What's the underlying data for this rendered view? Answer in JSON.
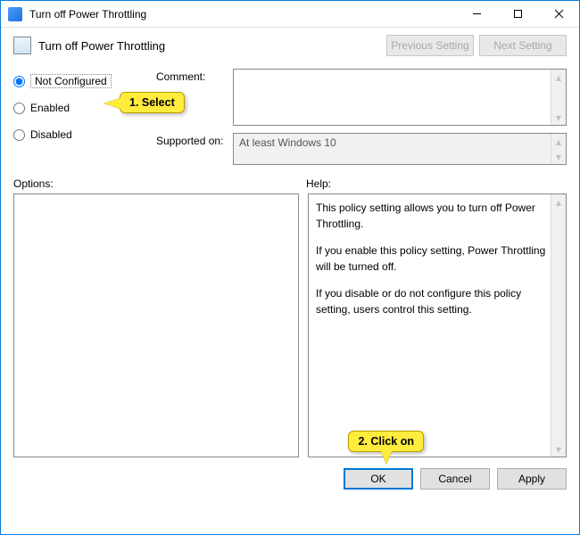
{
  "window": {
    "title": "Turn off Power Throttling"
  },
  "header": {
    "policy_title": "Turn off Power Throttling",
    "previous_setting": "Previous Setting",
    "next_setting": "Next Setting"
  },
  "radios": {
    "not_configured": "Not Configured",
    "enabled": "Enabled",
    "disabled": "Disabled",
    "selected": "not_configured"
  },
  "fields": {
    "comment_label": "Comment:",
    "comment_value": "",
    "supported_label": "Supported on:",
    "supported_value": "At least Windows 10"
  },
  "sections": {
    "options_label": "Options:",
    "help_label": "Help:"
  },
  "help": {
    "p1": "This policy setting allows you to turn off Power Throttling.",
    "p2": "If you enable this policy setting, Power Throttling will be turned off.",
    "p3": "If you disable or do not configure this policy setting, users control this setting."
  },
  "buttons": {
    "ok": "OK",
    "cancel": "Cancel",
    "apply": "Apply"
  },
  "annotations": {
    "select": "1. Select",
    "click_on": "2. Click on"
  }
}
